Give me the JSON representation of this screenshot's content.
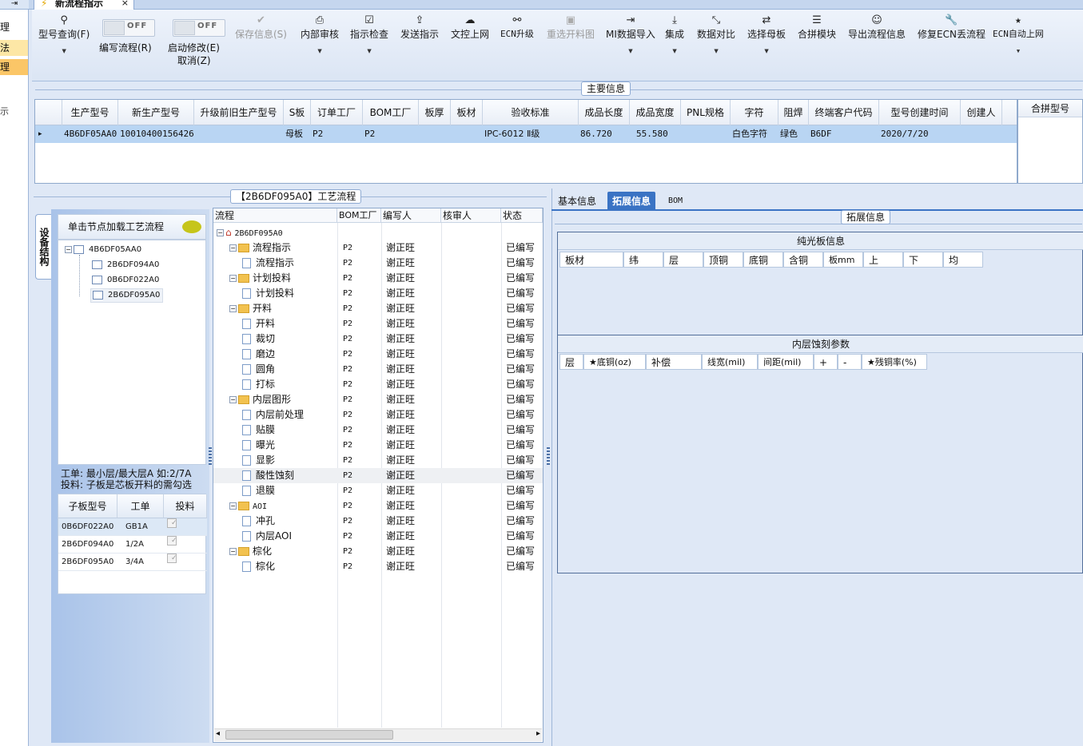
{
  "left_strip": {
    "items": [
      "理",
      "法",
      "理",
      "示"
    ]
  },
  "window": {
    "exit_icon": "exit-icon",
    "doc_tab": "新流程指示",
    "doc_tab_close": "×"
  },
  "toolbar": {
    "model_query": "型号查询(F)",
    "write_flow_toggle": "OFF",
    "write_flow": "编写流程(R)",
    "auto_modify_toggle": "OFF",
    "auto_modify_1": "启动修改(E)",
    "auto_modify_2": "取消(Z)",
    "save_info": "保存信息(S)",
    "internal_review": "内部审核",
    "instruction_check": "指示检查",
    "send_instruction": "发送指示",
    "doc_upload": "文控上网",
    "ecn_upgrade": "ECN升级",
    "reselect_cut_chart": "重选开料图",
    "mi_import": "MI数据导入",
    "integrate": "集成",
    "data_compare": "数据对比",
    "select_mother": "选择母板",
    "merge_module": "合拼模块",
    "export_flow": "导出流程信息",
    "repair_ecn": "修复ECN丢流程",
    "ecn_auto_upload": "ECN自动上网"
  },
  "main_info": {
    "title": "主要信息",
    "columns": [
      "生产型号",
      "新生产型号",
      "升级前旧生产型号",
      "S板",
      "订单工厂",
      "BOM工厂",
      "板厚",
      "板材",
      "验收标准",
      "成品长度",
      "成品宽度",
      "PNL规格",
      "字符",
      "阻焊",
      "终端客户代码",
      "型号创建时间",
      "创建人"
    ],
    "row": [
      "4B6DF05AA0",
      "10010400156426",
      "",
      "母板",
      "P2",
      "P2",
      "",
      "",
      "IPC-6012 Ⅱ级",
      "86.720",
      "55.580",
      "",
      "白色字符",
      "绿色",
      "B6DF",
      "2020/7/20",
      ""
    ],
    "row_marker": "▸",
    "merge_header": "合拼型号"
  },
  "side": {
    "tab_label": "设备结构",
    "tree_header": "单击节点加载工艺流程",
    "tree_nodes": [
      "4B6DF05AA0",
      "2B6DF094A0",
      "0B6DF022A0",
      "2B6DF095A0"
    ],
    "hint_1": "工单: 最小层/最大层A 如:2/7A",
    "hint_2": "投料: 子板是芯板开料的需勾选",
    "sub_headers": [
      "子板型号",
      "工单",
      "投料"
    ],
    "sub_rows": [
      {
        "model": "0B6DF022A0",
        "order": "GB1A",
        "check": "✓"
      },
      {
        "model": "2B6DF094A0",
        "order": "1/2A",
        "check": "✓"
      },
      {
        "model": "2B6DF095A0",
        "order": "3/4A",
        "check": "✓"
      }
    ]
  },
  "process": {
    "title": "【2B6DF095A0】工艺流程",
    "headers": [
      "流程",
      "BOM工厂",
      "编写人",
      "核审人",
      "状态"
    ],
    "root": "2B6DF095A0",
    "rows": [
      {
        "name": "流程指示",
        "factory": "P2",
        "writer": "谢正旺",
        "status": "已编写"
      },
      {
        "name": "流程指示",
        "factory": "P2",
        "writer": "谢正旺",
        "status": "已编写"
      },
      {
        "name": "计划投料",
        "factory": "P2",
        "writer": "谢正旺",
        "status": "已编写"
      },
      {
        "name": "计划投料",
        "factory": "P2",
        "writer": "谢正旺",
        "status": "已编写"
      },
      {
        "name": "开料",
        "factory": "P2",
        "writer": "谢正旺",
        "status": "已编写"
      },
      {
        "name": "开料",
        "factory": "P2",
        "writer": "谢正旺",
        "status": "已编写"
      },
      {
        "name": "裁切",
        "factory": "P2",
        "writer": "谢正旺",
        "status": "已编写"
      },
      {
        "name": "磨边",
        "factory": "P2",
        "writer": "谢正旺",
        "status": "已编写"
      },
      {
        "name": "圆角",
        "factory": "P2",
        "writer": "谢正旺",
        "status": "已编写"
      },
      {
        "name": "打标",
        "factory": "P2",
        "writer": "谢正旺",
        "status": "已编写"
      },
      {
        "name": "内层图形",
        "factory": "P2",
        "writer": "谢正旺",
        "status": "已编写"
      },
      {
        "name": "内层前处理",
        "factory": "P2",
        "writer": "谢正旺",
        "status": "已编写"
      },
      {
        "name": "贴膜",
        "factory": "P2",
        "writer": "谢正旺",
        "status": "已编写"
      },
      {
        "name": "曝光",
        "factory": "P2",
        "writer": "谢正旺",
        "status": "已编写"
      },
      {
        "name": "显影",
        "factory": "P2",
        "writer": "谢正旺",
        "status": "已编写"
      },
      {
        "name": "酸性蚀刻",
        "factory": "P2",
        "writer": "谢正旺",
        "status": "已编写"
      },
      {
        "name": "退膜",
        "factory": "P2",
        "writer": "谢正旺",
        "status": "已编写"
      },
      {
        "name": "AOI",
        "factory": "P2",
        "writer": "谢正旺",
        "status": "已编写"
      },
      {
        "name": "冲孔",
        "factory": "P2",
        "writer": "谢正旺",
        "status": "已编写"
      },
      {
        "name": "内层AOI",
        "factory": "P2",
        "writer": "谢正旺",
        "status": "已编写"
      },
      {
        "name": "棕化",
        "factory": "P2",
        "writer": "谢正旺",
        "status": "已编写"
      },
      {
        "name": "棕化",
        "factory": "P2",
        "writer": "谢正旺",
        "status": "已编写"
      }
    ],
    "scroll_left": "◂",
    "scroll_right": "▸"
  },
  "right": {
    "tabs": [
      "基本信息",
      "拓展信息",
      "BOM"
    ],
    "ext_title": "拓展信息",
    "bare_title": "纯光板信息",
    "bare_headers": [
      "板材",
      "纬",
      "层",
      "顶铜",
      "底铜",
      "含铜",
      "板mm",
      "上",
      "下",
      "均"
    ],
    "etch_title": "内层蚀刻参数",
    "etch_headers": [
      "层",
      "★底铜(oz)",
      "补偿",
      "线宽(mil)",
      "间距(mil)",
      "+",
      "-",
      "★残铜率(%)"
    ]
  },
  "colors": {
    "selected_row": "#b9d5f3",
    "accent": "#3a73c4",
    "folder": "#f2c24f"
  }
}
